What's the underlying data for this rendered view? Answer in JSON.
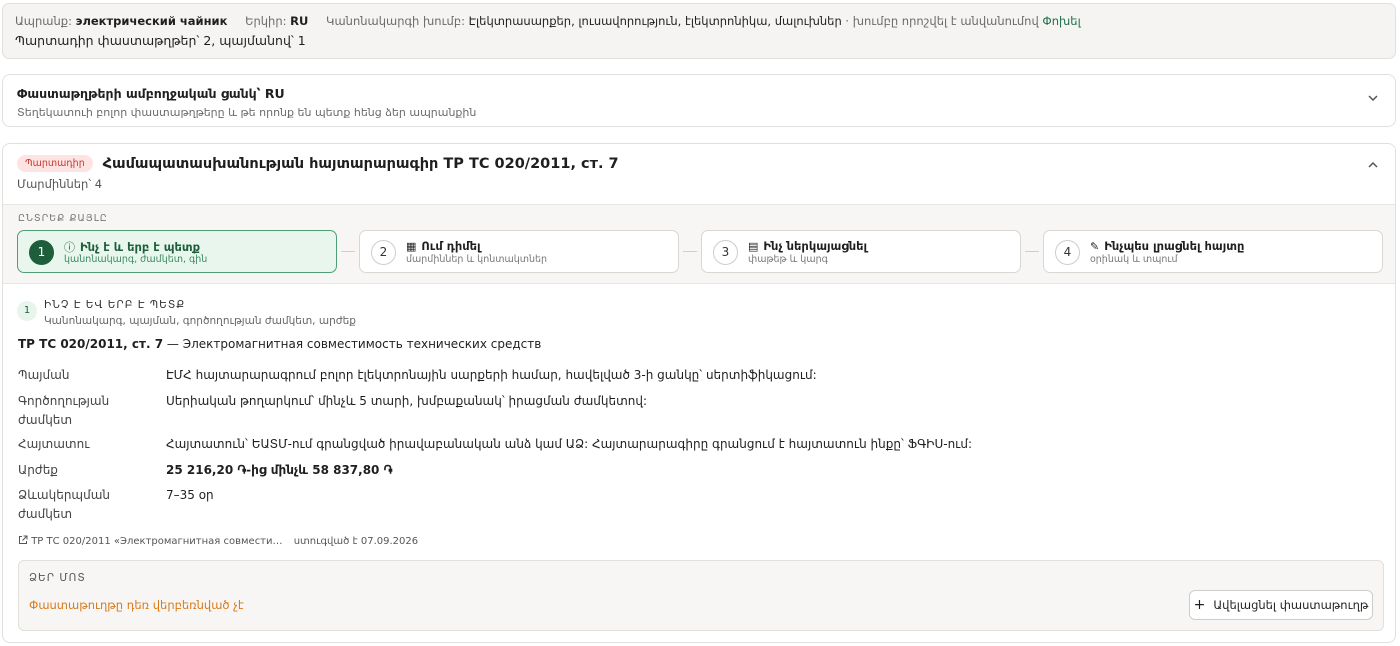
{
  "topbar": {
    "product_label": "Ապրանք:",
    "product_value": "электрический чайник",
    "country_label": "Երկիր:",
    "country_value": "RU",
    "group_label": "Կանոնակարգի խումբ:",
    "group_value": "Էլեկտրասարքեր, լուսավորություն, էլեկտրոնիկա, մալուխներ",
    "group_note": "· խումբը որոշվել է անվանումով",
    "change_link": "Փոխել",
    "summary": "Պարտադիր փաստաթղթեր՝ 2, պայմանով՝ 1"
  },
  "full_list": {
    "title": "Փաստաթղթերի ամբողջական ցանկ՝ RU",
    "subtitle": "Տեղեկատուի բոլոր փաստաթղթերը և թե որոնք են պետք հենց ձեր ապրանքին"
  },
  "document": {
    "badge": "Պարտադիր",
    "title": "Համապատասխանության հայտարարագիր ТР ТС 020/2011, ст. 7",
    "meta": "Մարմիններ՝ 4",
    "steps_label": "ԸՆՏՐԵՔ ՔԱՅԼԸ",
    "steps": [
      {
        "num": "1",
        "title": "Ինչ է և երբ է պետք",
        "subtitle": "կանոնակարգ, ժամկետ, գին"
      },
      {
        "num": "2",
        "title": "Ում դիմել",
        "subtitle": "մարմիններ և կոնտակտներ"
      },
      {
        "num": "3",
        "title": "Ինչ ներկայացնել",
        "subtitle": "փաթեթ և կարգ"
      },
      {
        "num": "4",
        "title": "Ինչպես լրացնել հայտը",
        "subtitle": "օրինակ և տպում"
      }
    ],
    "section": {
      "num": "1",
      "heading": "ԻՆՉ Է ԵՎ ԵՐԲ Է ՊԵՏՔ",
      "subheading": "Կանոնակարգ, պայման, գործողության ժամկետ, արժեք"
    },
    "regulation_code": "ТР ТС 020/2011, ст. 7",
    "regulation_name": " — Электромагнитная совместимость технических средств",
    "details": {
      "condition_label": "Պայման",
      "condition_value": "ԷՄՀ հայտարարագրում բոլոր էլեկտրոնային սարքերի համար, հավելված 3-ի ցանկը՝ սերտիֆիկացում:",
      "validity_label": "Գործողության ժամկետ",
      "validity_value": "Սերիական թողարկում՝ մինչև 5 տարի, խմբաքանակ՝ իրացման ժամկետով:",
      "applicant_label": "Հայտատու",
      "applicant_value": "Հայտատուն՝ ԵԱՏՄ-ում գրանցված իրավաբանական անձ կամ ԱՁ: Հայտարարագիրը գրանցում է հայտատուն ինքը՝ ՖԳԻՍ-ում:",
      "cost_label": "Արժեք",
      "cost_value": "25 216,20 ֏-ից մինչև 58 837,80 ֏",
      "term_label": "Ձևակերպման ժամկետ",
      "term_value": "7–35 օր"
    },
    "source_link": "ТР ТС 020/2011 «Электромагнитная совмести…",
    "source_checked": "ստուգված է 07.09.2026",
    "yours": {
      "label": "ՁԵՐ ՄՈՏ",
      "status": "Փաստաթուղթը դեռ վերբեռնված չէ",
      "add_button": "Ավելացնել փաստաթուղթ"
    }
  }
}
